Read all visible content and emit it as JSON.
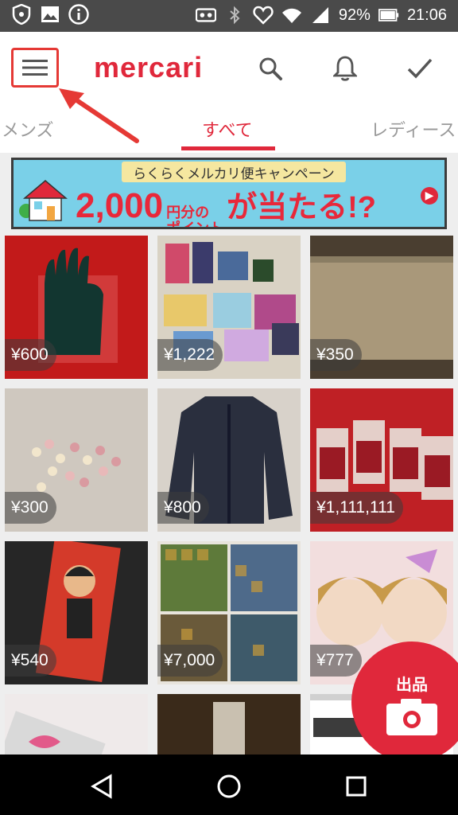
{
  "status_bar": {
    "battery": "92%",
    "time": "21:06",
    "left_icons": [
      "shield-icon",
      "image-icon",
      "info-icon"
    ],
    "right_icons": [
      "voicemail-icon",
      "bluetooth-icon",
      "heart-icon",
      "wifi-icon",
      "signal-icon",
      "battery-icon"
    ]
  },
  "header": {
    "logo": "mercari",
    "actions": [
      "search-icon",
      "bell-icon",
      "check-icon"
    ]
  },
  "tabs": [
    {
      "label": "メンズ",
      "active": false
    },
    {
      "label": "すべて",
      "active": true
    },
    {
      "label": "レディース",
      "active": false
    }
  ],
  "banner": {
    "headline": "らくらくメルカリ便キャンペーン",
    "amount": "2,000",
    "unit_top": "円分の",
    "unit_bottom": "ポイント",
    "tail": "が当たる!?"
  },
  "items": [
    {
      "price": "¥600",
      "bg": "#c21a1a"
    },
    {
      "price": "¥1,222",
      "bg": "#d9d2c4"
    },
    {
      "price": "¥350",
      "bg": "#8a7d63"
    },
    {
      "price": "¥300",
      "bg": "#cfc8bf"
    },
    {
      "price": "¥800",
      "bg": "#d8d2ca"
    },
    {
      "price": "¥1,111,111",
      "bg": "#bf2025"
    },
    {
      "price": "¥540",
      "bg": "#262626"
    },
    {
      "price": "¥7,000",
      "bg": "#5e7a3a"
    },
    {
      "price": "¥777",
      "bg": "#e8c9c9"
    },
    {
      "price": "",
      "bg": "#e6e0e0"
    },
    {
      "price": "",
      "bg": "#6b4a2a"
    },
    {
      "price": "",
      "bg": "#ffffff"
    }
  ],
  "sell_button": {
    "label": "出品"
  },
  "nav": [
    "back-icon",
    "home-icon",
    "recents-icon"
  ],
  "colors": {
    "brand": "#e0283b"
  }
}
